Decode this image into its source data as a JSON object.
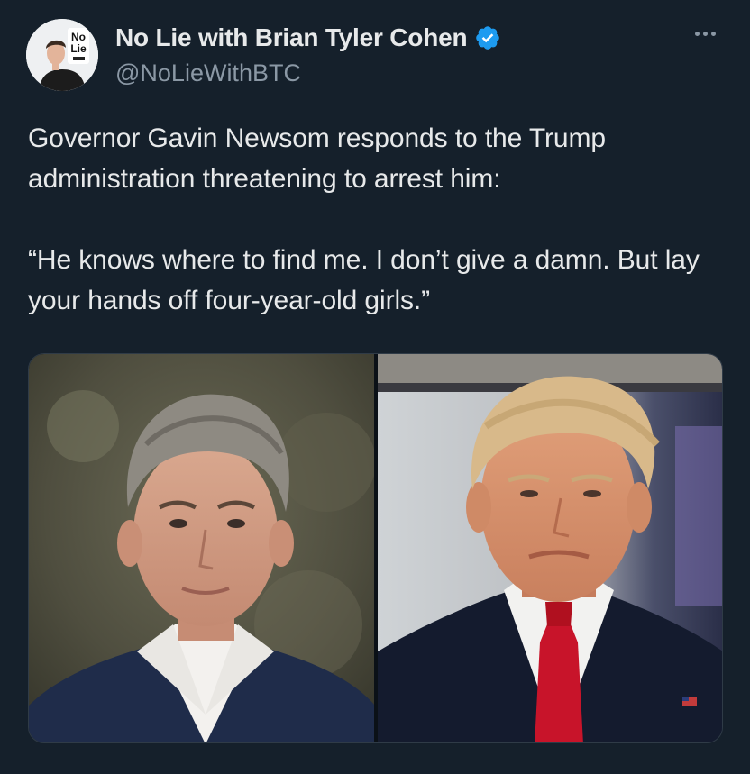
{
  "account": {
    "display_name": "No Lie with Brian Tyler Cohen",
    "handle": "@NoLieWithBTC",
    "avatar_logo_text": "No Lie",
    "verified": true,
    "accent_color": "#1d9bf0"
  },
  "tweet": {
    "text": "Governor Gavin Newsom responds to the Trump administration threatening to arrest him:\n\n“He knows where to find me. I don’t give a damn. But lay your hands off four-year-old girls.”"
  },
  "media": {
    "photos": [
      {
        "icon": "portrait-photo"
      },
      {
        "icon": "portrait-photo"
      }
    ]
  },
  "icons": {
    "more": "more-options-icon",
    "verified": "verified-badge-icon"
  }
}
